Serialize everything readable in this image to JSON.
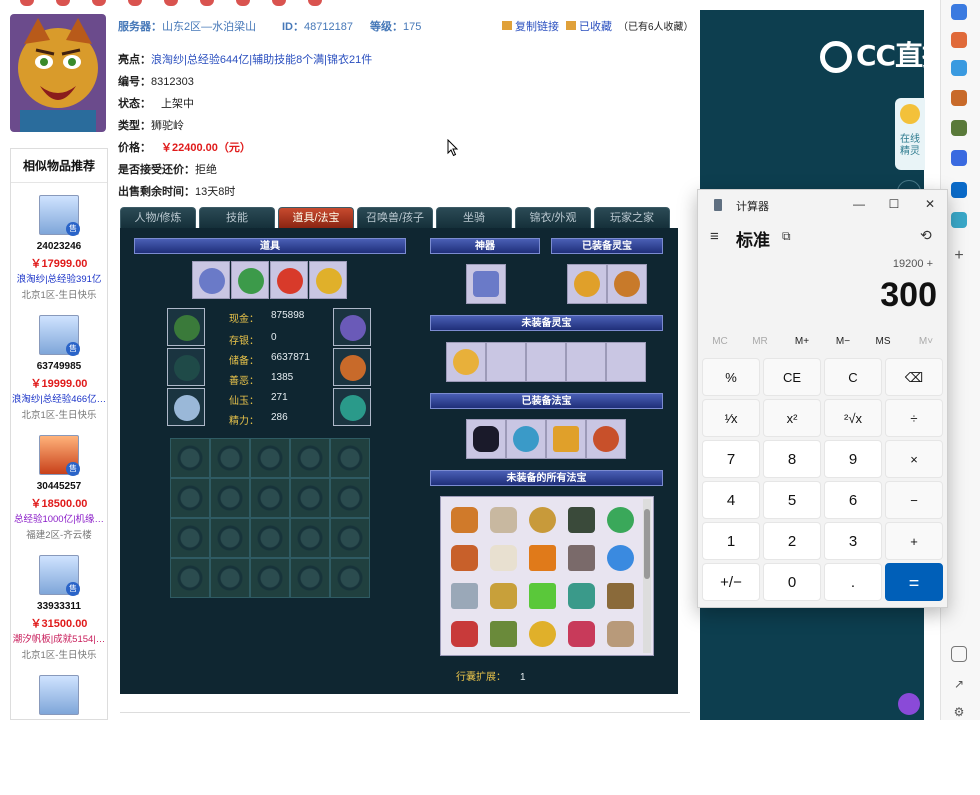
{
  "listing": {
    "server_label": "服务器：",
    "server_value": "山东2区—水泊梁山",
    "id_label": "ID：",
    "id_value": "48712187",
    "level_label": "等级：",
    "level_value": "175",
    "copy_link": "复制链接",
    "favorited": "已收藏",
    "fav_count": "（已有6人收藏）",
    "highlight_label": "亮点：",
    "highlight_value": "浪淘纱|总经验644亿|辅助技能8个满|锦衣21件",
    "number_label": "编号：",
    "number_value": "8312303",
    "status_label": "状态：",
    "status_value": "上架中",
    "type_label": "类型：",
    "type_value": "狮驼岭",
    "price_label": "价格：",
    "price_value": "￥22400.00（元）",
    "bargain_label": "是否接受还价：",
    "bargain_value": "拒绝",
    "time_label": "出售剩余时间：",
    "time_value": "13天8时"
  },
  "similar": {
    "title": "相似物品推荐",
    "items": [
      {
        "id": "24023246",
        "price": "￥17999.00",
        "desc": "浪淘纱|总经验391亿",
        "server": "北京1区-生日快乐"
      },
      {
        "id": "63749985",
        "price": "￥19999.00",
        "desc": "浪淘纱|总经验466亿…",
        "server": "北京1区-生日快乐"
      },
      {
        "id": "30445257",
        "price": "￥18500.00",
        "desc": "总经验1000亿|机缘…",
        "server": "福建2区-齐云楼"
      },
      {
        "id": "33933311",
        "price": "￥31500.00",
        "desc": "潮汐帆板|成就5154|…",
        "server": "北京1区-生日快乐"
      }
    ],
    "badge": "售"
  },
  "tabs": [
    "人物/修炼",
    "技能",
    "道具/法宝",
    "召唤兽/孩子",
    "坐骑",
    "锦衣/外观",
    "玩家之家"
  ],
  "game": {
    "items_bar": "道具",
    "artifact_bar": "神器",
    "equipped_spirit_bar": "已装备灵宝",
    "unequipped_spirit_bar": "未装备灵宝",
    "equipped_treasure_bar": "已装备法宝",
    "all_treasure_bar": "未装备的所有法宝",
    "stats": [
      {
        "k": "现金：",
        "v": "875898"
      },
      {
        "k": "存银：",
        "v": "0"
      },
      {
        "k": "储备：",
        "v": "6637871"
      },
      {
        "k": "善恶：",
        "v": "1385"
      },
      {
        "k": "仙玉：",
        "v": "271"
      },
      {
        "k": "精力：",
        "v": "286"
      }
    ],
    "bag_label": "行囊扩展：",
    "bag_value": "1"
  },
  "brand": {
    "logo": "CC直播"
  },
  "assistant": {
    "line1": "在线",
    "line2": "精灵"
  },
  "calculator": {
    "title": "计算器",
    "menu_icon": "≡",
    "mode": "标准",
    "mode_icon": "⧉",
    "history_icon": "⟲",
    "expression": "19200 +",
    "display": "300",
    "memory": [
      "MC",
      "MR",
      "M+",
      "M−",
      "MS",
      "M˅"
    ],
    "keys": [
      [
        "%",
        "CE",
        "C",
        "⌫"
      ],
      [
        "¹⁄x",
        "x²",
        "²√x",
        "÷"
      ],
      [
        "7",
        "8",
        "9",
        "×"
      ],
      [
        "4",
        "5",
        "6",
        "−"
      ],
      [
        "1",
        "2",
        "3",
        "+"
      ],
      [
        "+/−",
        "0",
        ".",
        "="
      ]
    ],
    "minimize": "—",
    "maximize": "☐",
    "close": "✕"
  },
  "colors": {
    "price_red": "#e01b1b",
    "link_blue": "#2a4fbf",
    "calc_accent": "#005fb8",
    "panel_bg": "#0f2631"
  }
}
